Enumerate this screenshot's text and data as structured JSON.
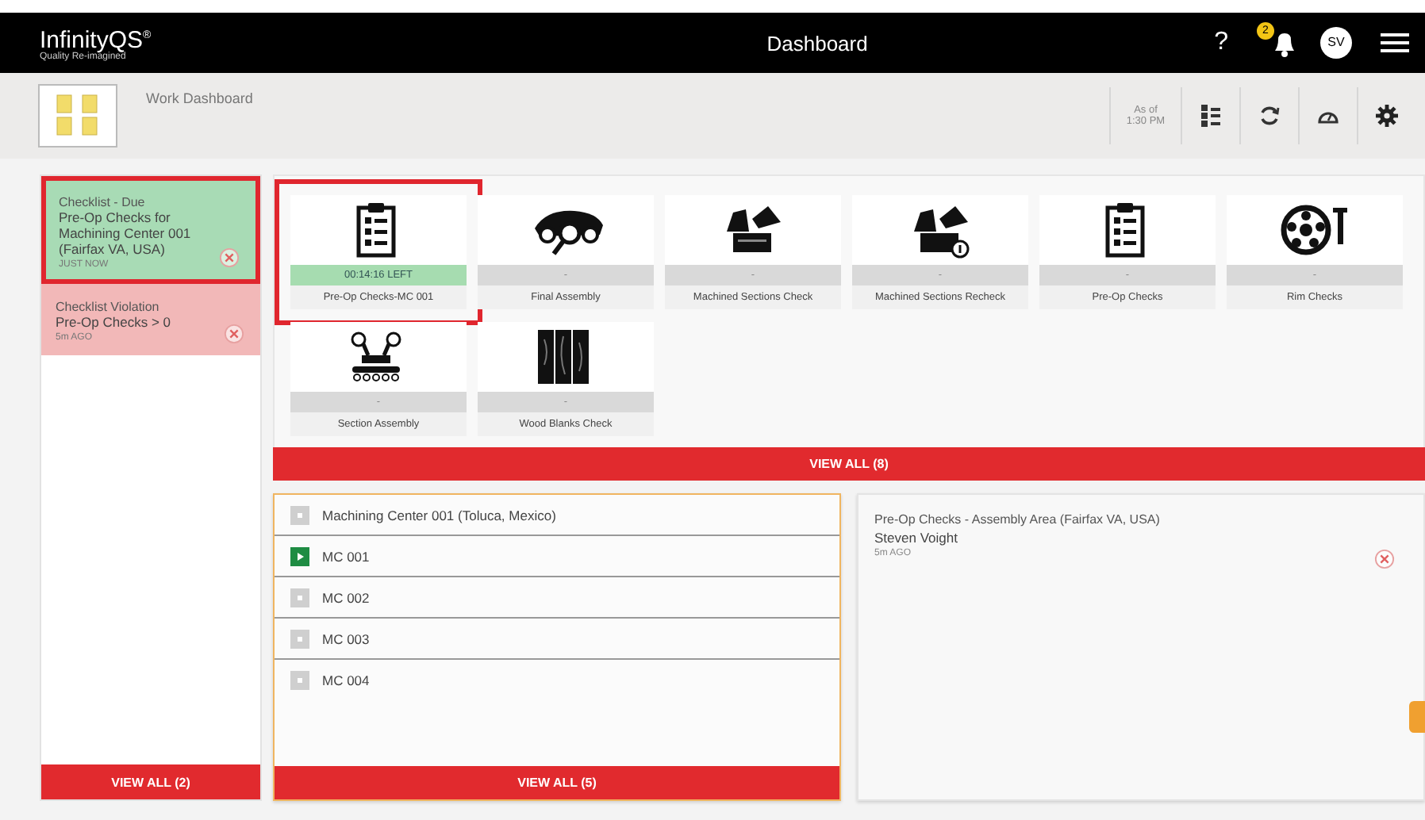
{
  "header": {
    "logo": "InfinityQS$^{®}$",
    "tagline": "Quality Re-imagined",
    "title": "Dashboard",
    "help": "?",
    "notification_count": "2",
    "avatar": "SV"
  },
  "toolbar": {
    "title": "Work Dashboard",
    "as_of": "As of 1:30 PM"
  },
  "notifications": [
    {
      "kind": "due",
      "heading": "Checklist - Due",
      "detail": "Pre-Op Checks for Machining Center 001 (Fairfax VA, USA)",
      "time": "JUST NOW",
      "highlighted": true
    },
    {
      "kind": "violation",
      "heading": "Checklist Violation",
      "detail": "Pre-Op Checks > 0",
      "time": "5m AGO",
      "highlighted": false
    }
  ],
  "notifications_view_all": "VIEW ALL (2)",
  "tiles": [
    {
      "kind": "clipboard",
      "status": "00:14:16 LEFT",
      "active": true,
      "highlighted": true,
      "label": "Pre-Op Checks-MC 001"
    },
    {
      "kind": "car",
      "status": "-",
      "active": false,
      "highlighted": false,
      "label": "Final Assembly"
    },
    {
      "kind": "enact",
      "status": "-",
      "active": false,
      "highlighted": false,
      "label": "Machined Sections Check"
    },
    {
      "kind": "enact-recheck",
      "status": "-",
      "active": false,
      "highlighted": false,
      "label": "Machined Sections Recheck"
    },
    {
      "kind": "clipboard",
      "status": "-",
      "active": false,
      "highlighted": false,
      "label": "Pre-Op Checks"
    },
    {
      "kind": "wheel",
      "status": "-",
      "active": false,
      "highlighted": false,
      "label": "Rim Checks"
    },
    {
      "kind": "robot",
      "status": "-",
      "active": false,
      "highlighted": false,
      "label": "Section Assembly"
    },
    {
      "kind": "wood",
      "status": "-",
      "active": false,
      "highlighted": false,
      "label": "Wood Blanks Check"
    }
  ],
  "tiles_view_all": "VIEW ALL (8)",
  "machines": [
    {
      "name": "Machining Center 001 (Toluca, Mexico)",
      "running": false
    },
    {
      "name": "MC 001",
      "running": true
    },
    {
      "name": "MC 002",
      "running": false
    },
    {
      "name": "MC 003",
      "running": false
    },
    {
      "name": "MC 004",
      "running": false
    }
  ],
  "machines_view_all": "VIEW ALL (5)",
  "alert": {
    "title": "Pre-Op Checks - Assembly Area (Fairfax VA, USA)",
    "person": "Steven Voight",
    "time": "5m AGO"
  }
}
